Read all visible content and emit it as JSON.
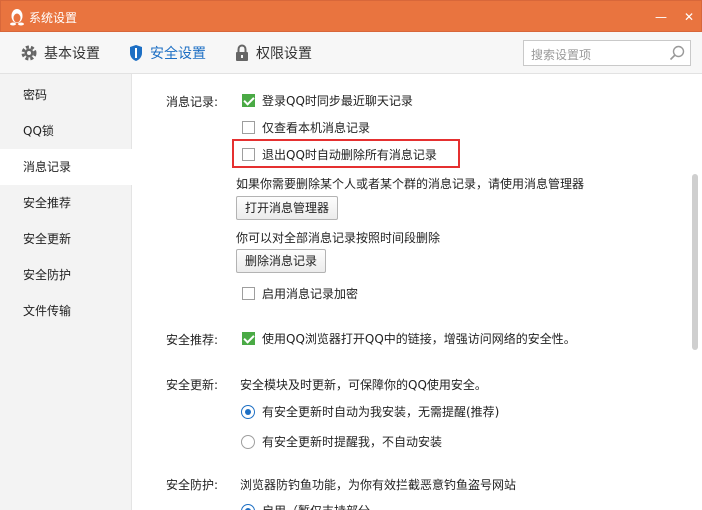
{
  "window": {
    "title": "系统设置",
    "minimize_glyph": "—",
    "close_glyph": "✕"
  },
  "tabs": [
    {
      "label": "基本设置",
      "icon": "gear-icon"
    },
    {
      "label": "安全设置",
      "icon": "shield-icon",
      "active": true
    },
    {
      "label": "权限设置",
      "icon": "lock-icon"
    }
  ],
  "search": {
    "placeholder": "搜索设置项"
  },
  "sidebar": {
    "items": [
      {
        "label": "密码"
      },
      {
        "label": "QQ锁"
      },
      {
        "label": "消息记录",
        "active": true
      },
      {
        "label": "安全推荐"
      },
      {
        "label": "安全更新"
      },
      {
        "label": "安全防护"
      },
      {
        "label": "文件传输"
      }
    ]
  },
  "message_record": {
    "label": "消息记录:",
    "opt_sync": {
      "text": "登录QQ时同步最近聊天记录",
      "checked": true
    },
    "opt_local_only": {
      "text": "仅查看本机消息记录",
      "checked": false
    },
    "opt_auto_delete": {
      "text": "退出QQ时自动删除所有消息记录",
      "checked": false
    },
    "hint_manager": "如果你需要删除某个人或者某个群的消息记录，请使用消息管理器",
    "open_manager_button": "打开消息管理器",
    "hint_delete": "你可以对全部消息记录按照时间段删除",
    "delete_button": "删除消息记录",
    "opt_encrypt": {
      "text": "启用消息记录加密",
      "checked": false
    }
  },
  "security_recommend": {
    "label": "安全推荐:",
    "opt_browser": {
      "text": "使用QQ浏览器打开QQ中的链接，增强访问网络的安全性。",
      "checked": true
    }
  },
  "security_update": {
    "label": "安全更新:",
    "desc": "安全模块及时更新，可保障你的QQ使用安全。",
    "radio_auto": {
      "text": "有安全更新时自动为我安装，无需提醒(推荐)",
      "selected": true
    },
    "radio_notify": {
      "text": "有安全更新时提醒我，不自动安装",
      "selected": false
    }
  },
  "security_protect": {
    "label": "安全防护:",
    "desc": "浏览器防钓鱼功能，为你有效拦截恶意钓鱼盗号网站",
    "radio_enable_partial": "启用（暂仅支持部分",
    "radio_enable_selected": true
  },
  "colors": {
    "titlebar": "#e9743f",
    "accent": "#1d6fc4",
    "check": "#4aaa45",
    "highlight": "#e53030"
  }
}
